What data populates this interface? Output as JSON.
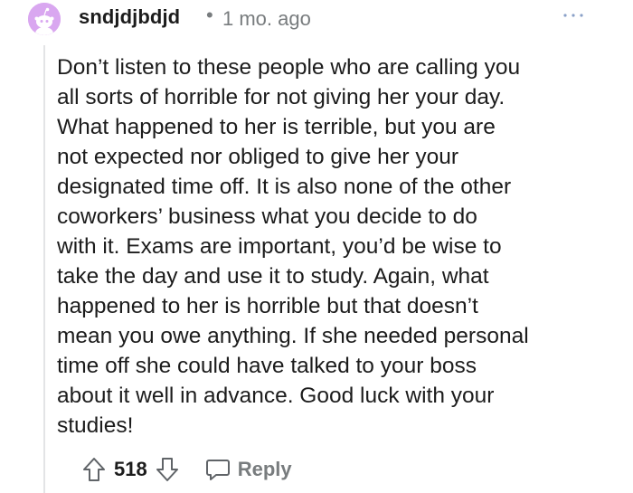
{
  "comment": {
    "username": "sndjdjbdjd",
    "separator": "•",
    "timestamp": "1 mo. ago",
    "body": "Don’t listen to these people who are calling you\nall sorts of horrible for not giving her your day.\nWhat happened to her is terrible, but you are\nnot expected nor obliged to give her your\ndesignated time off. It is also none of the other\ncoworkers’ business what you decide to do\nwith it. Exams are important, you’d be wise to\ntake the day and use it to study. Again, what\nhappened to her is horrible but that doesn’t\nmean you owe anything. If she needed personal\ntime off she could have talked to your boss\nabout it well in advance. Good luck with your\nstudies!",
    "score": "518",
    "reply_label": "Reply"
  },
  "icons": {
    "avatar": "snoo-avatar-icon",
    "more": "more-options-icon",
    "upvote": "upvote-arrow-icon",
    "downvote": "downvote-arrow-icon",
    "reply": "comment-bubble-icon"
  },
  "colors": {
    "avatar_bg": "#d9a7f0",
    "text": "#1c1c1c",
    "meta": "#787c7e",
    "thread_line": "#e3e4e6"
  }
}
